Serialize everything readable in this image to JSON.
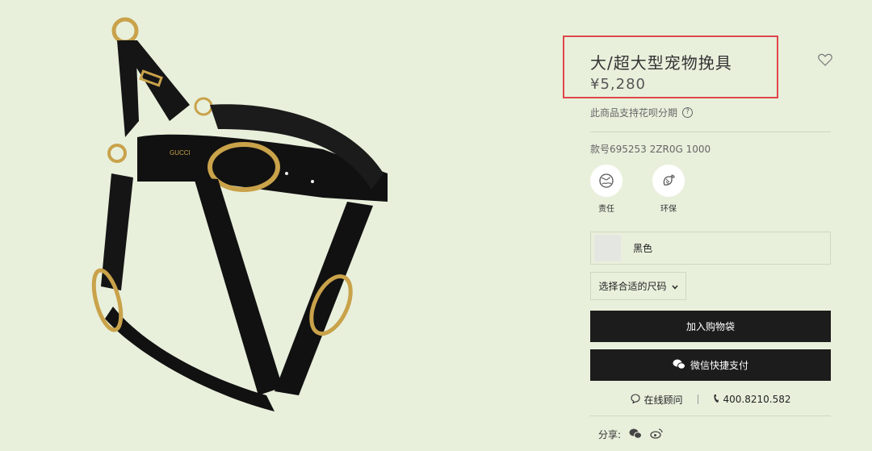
{
  "product": {
    "title": "大/超大型宠物挽具",
    "price": "¥5,280",
    "installment_text": "此商品支持花呗分期",
    "help_icon": "?",
    "sku": "款号695253 2ZR0G 1000",
    "brand_logo": "GUCCI"
  },
  "badges": [
    {
      "label": "责任",
      "icon": "globe-icon"
    },
    {
      "label": "环保",
      "icon": "leaf-recycle-icon"
    }
  ],
  "color": {
    "label": "黑色",
    "swatch": "#e4e7e1"
  },
  "size": {
    "label": "选择合适的尺码"
  },
  "buttons": {
    "add_to_bag": "加入购物袋",
    "wechat_pay": "微信快捷支付"
  },
  "contact": {
    "chat_label": "在线顾问",
    "phone": "400.8210.582"
  },
  "share": {
    "label": "分享:"
  },
  "colors": {
    "background": "#e8f0dc",
    "button": "#1c1c1c",
    "highlight": "#e0474c"
  }
}
